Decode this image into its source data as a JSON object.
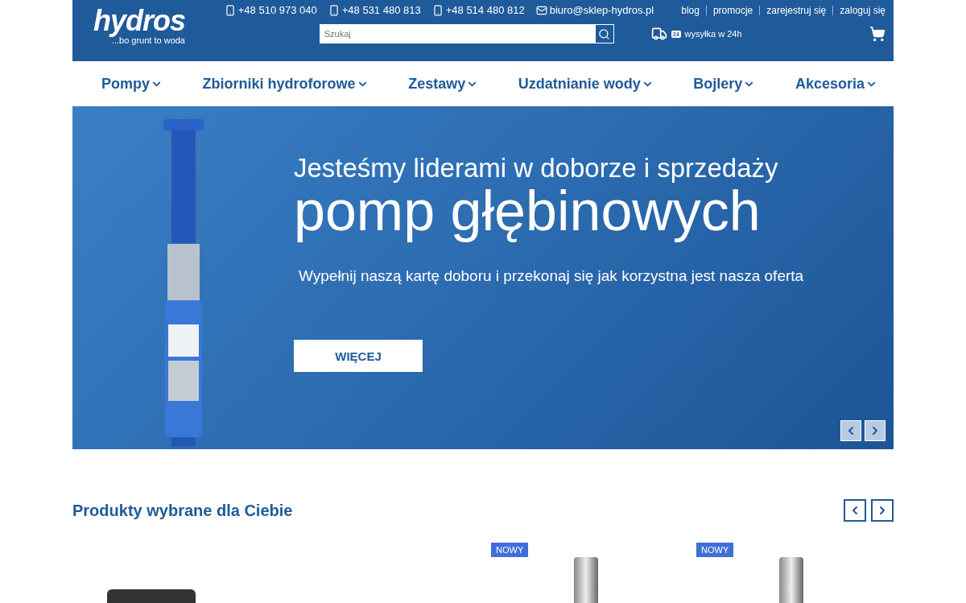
{
  "header": {
    "logo": "hydros",
    "tagline": "...bo grunt to woda",
    "contacts": [
      {
        "kind": "phone",
        "text": "+48 510 973 040"
      },
      {
        "kind": "phone",
        "text": "+48 531 480 813"
      },
      {
        "kind": "phone",
        "text": "+48 514 480 812"
      },
      {
        "kind": "email",
        "text": "biuro@sklep-hydros.pl"
      }
    ],
    "links": [
      "blog",
      "promocje",
      "zarejestruj się",
      "zaloguj się"
    ],
    "search": {
      "placeholder": "Szukaj"
    },
    "shipping": {
      "badge": "24",
      "text": "wysyłka w 24h"
    }
  },
  "nav": [
    "Pompy",
    "Zbiorniki hydroforowe",
    "Zestawy",
    "Uzdatnianie wody",
    "Bojlery",
    "Akcesoria"
  ],
  "hero": {
    "kicker": "Jesteśmy liderami w doborze i sprzedaży",
    "title": "pomp głębinowych",
    "subtitle": "Wypełnij naszą kartę doboru i przekonaj się jak korzystna jest nasza oferta",
    "button": "WIĘCEJ"
  },
  "products_section": {
    "title": "Produkty wybrane dla Ciebie",
    "products": [
      {
        "kind": "controller"
      },
      {
        "kind": "empty"
      },
      {
        "kind": "pump",
        "badge": "NOWY"
      },
      {
        "kind": "pump",
        "badge": "NOWY"
      }
    ]
  }
}
